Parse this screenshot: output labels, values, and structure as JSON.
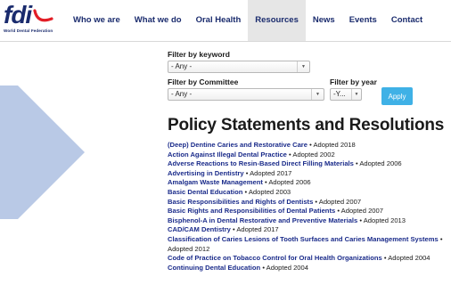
{
  "brand": {
    "logo_text": "fdi",
    "logo_subtitle": "World Dental Federation",
    "primary_color": "#1a2b6d",
    "accent_color": "#e21e26",
    "apply_color": "#3fb1e6"
  },
  "nav": {
    "items": [
      "Who we are",
      "What we do",
      "Oral Health",
      "Resources",
      "News",
      "Events",
      "Contact"
    ],
    "active": "Resources"
  },
  "filters": {
    "keyword_label": "Filter by keyword",
    "keyword_value": "- Any -",
    "committee_label": "Filter by Committee",
    "committee_value": "- Any -",
    "year_label": "Filter by year",
    "year_value": "-Y...",
    "apply_label": "Apply"
  },
  "page_title": "Policy Statements and Resolutions",
  "policies": [
    {
      "title": "(Deep) Dentine Caries and Restorative Care",
      "meta": " • Adopted 2018"
    },
    {
      "title": "Action Against Illegal Dental Practice",
      "meta": " • Adopted 2002"
    },
    {
      "title": "Adverse Reactions to Resin-Based Direct Filling Materials",
      "meta": " • Adopted 2006"
    },
    {
      "title": "Advertising in Dentistry",
      "meta": " • Adopted 2017"
    },
    {
      "title": "Amalgam Waste Management",
      "meta": " • Adopted 2006"
    },
    {
      "title": "Basic Dental Education",
      "meta": " • Adopted 2003"
    },
    {
      "title": "Basic Responsibilities and Rights of Dentists",
      "meta": " • Adopted 2007"
    },
    {
      "title": "Basic Rights and Responsibilities of Dental Patients",
      "meta": " • Adopted 2007"
    },
    {
      "title": "Bisphenol-A in Dental Restorative and Preventive Materials",
      "meta": " • Adopted 2013"
    },
    {
      "title": "CAD/CAM Dentistry",
      "meta": " • Adopted 2017"
    },
    {
      "title": "Classification of Caries Lesions of Tooth Surfaces and Caries Management Systems",
      "meta": " • Adopted 2012"
    },
    {
      "title": "Code of Practice on Tobacco Control for Oral Health Organizations",
      "meta": " • Adopted 2004"
    },
    {
      "title": "Continuing Dental Education",
      "meta": " • Adopted 2004"
    }
  ]
}
